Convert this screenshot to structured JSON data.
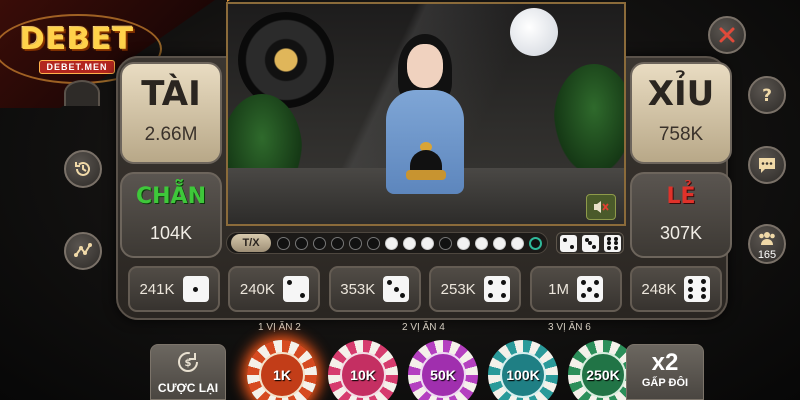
{
  "logo": {
    "main": "DEBET",
    "sub": "DEBET.MEN"
  },
  "bets": {
    "tai": {
      "label": "TÀI",
      "amount": "2.66M"
    },
    "xiu": {
      "label": "XỈU",
      "amount": "758K"
    },
    "chan": {
      "label": "CHẴN",
      "amount": "104K"
    },
    "le": {
      "label": "LẺ",
      "amount": "307K"
    }
  },
  "history": {
    "toggle_label": "T/X",
    "results": [
      "black",
      "black",
      "black",
      "black",
      "black",
      "black",
      "white",
      "white",
      "white",
      "black",
      "white",
      "white",
      "white",
      "white",
      "current"
    ]
  },
  "dice_bets": [
    {
      "amount": "241K",
      "face": 1
    },
    {
      "amount": "240K",
      "face": 2
    },
    {
      "amount": "353K",
      "face": 3
    },
    {
      "amount": "253K",
      "face": 4
    },
    {
      "amount": "1M",
      "face": 5
    },
    {
      "amount": "248K",
      "face": 6
    }
  ],
  "payouts": [
    "1 VỊ ĂN 2",
    "2 VỊ ĂN 4",
    "3 VỊ ĂN 6"
  ],
  "controls": {
    "rebet_label": "CƯỢC LẠI",
    "double_multiplier": "x2",
    "double_label": "GẤP ĐÔI"
  },
  "chips": [
    "1K",
    "10K",
    "50K",
    "100K",
    "250K"
  ],
  "selected_chip": "1K",
  "players": {
    "count": "165"
  },
  "icons": {
    "close": "close-icon",
    "help": "help-icon",
    "chat": "chat-icon",
    "history": "history-icon",
    "stats": "stats-icon",
    "players": "players-icon",
    "mute": "mute-icon",
    "rebet": "rebet-icon"
  },
  "colors": {
    "accent_gold": "#e29a3b",
    "chan_green": "#3ec83a",
    "le_red": "#e0322a",
    "chip_1k": "#d64a20",
    "chip_10k": "#d63c6e",
    "chip_50k": "#b440c0",
    "chip_100k": "#2a9a9a",
    "chip_250k": "#2c8f5a"
  }
}
